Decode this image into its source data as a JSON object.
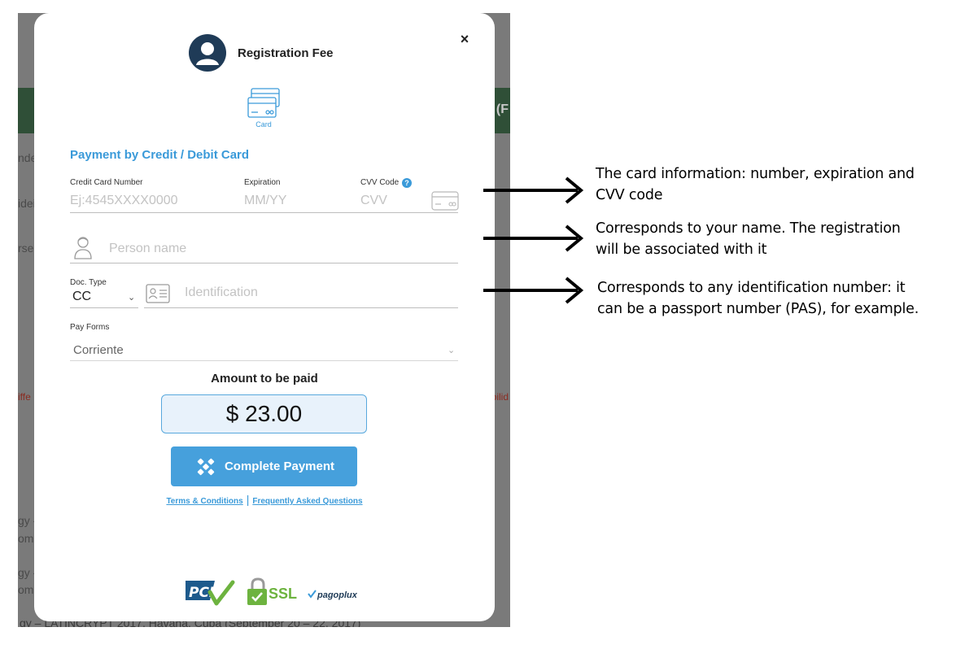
{
  "background": {
    "band_text": "(F",
    "fragments": [
      "nde",
      "idei",
      "rse",
      "iffe",
      "bilid",
      "gy -",
      "om",
      "gy -",
      "om"
    ],
    "bottom_text": "gy – LATINCRYPT 2017. Havana, Cuba (September 20 – 22, 2017)"
  },
  "modal": {
    "title": "Registration Fee",
    "close_label": "×",
    "payment_method": {
      "label": "Card"
    },
    "section_title": "Payment by Credit / Debit Card",
    "card_number": {
      "label": "Credit Card Number",
      "placeholder": "Ej:4545XXXX0000"
    },
    "expiration": {
      "label": "Expiration",
      "placeholder": "MM/YY"
    },
    "cvv": {
      "label": "CVV Code",
      "placeholder": "CVV",
      "help_icon": "?"
    },
    "person": {
      "placeholder": "Person name"
    },
    "doc_type": {
      "label": "Doc. Type",
      "value": "CC"
    },
    "identification": {
      "placeholder": "Identification"
    },
    "pay_forms": {
      "label": "Pay Forms",
      "value": "Corriente"
    },
    "amount": {
      "label": "Amount to be paid",
      "value": "$ 23.00"
    },
    "submit_label": "Complete Payment",
    "links": {
      "terms": "Terms & Conditions",
      "faq": "Frequently Asked Questions"
    },
    "badges": [
      "PCI",
      "SSL",
      "pagoplux"
    ]
  },
  "annotations": [
    {
      "text_line1": "The card information: number, expiration and",
      "text_line2": "CVV code"
    },
    {
      "text_line1": "Corresponds to your name. The registration",
      "text_line2": "will be associated with it"
    },
    {
      "text_line1": "Corresponds to any identification number: it",
      "text_line2": "can be a passport number (PAS), for example."
    }
  ],
  "colors": {
    "accent": "#3a9ad9",
    "button": "#46a0dc",
    "overlay": "#7a7a7a",
    "band": "#2f4f37"
  }
}
